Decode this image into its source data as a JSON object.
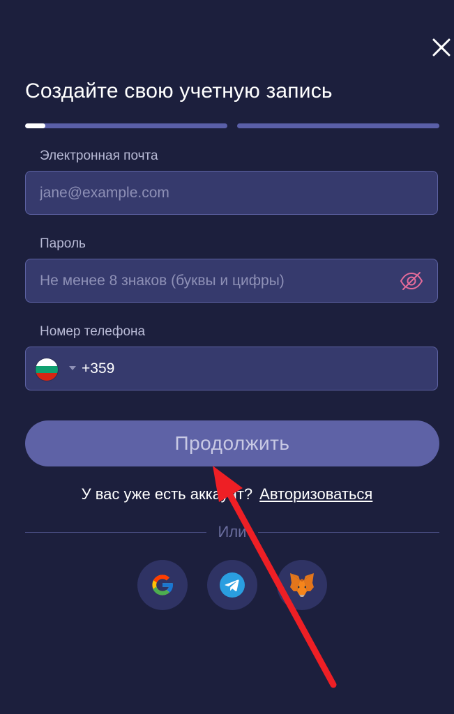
{
  "title": "Создайте свою учетную запись",
  "progress": [
    0.1,
    0
  ],
  "email": {
    "label": "Электронная почта",
    "placeholder": "jane@example.com",
    "value": ""
  },
  "password": {
    "label": "Пароль",
    "placeholder": "Не менее 8 знаков (буквы и цифры)",
    "value": ""
  },
  "phone": {
    "label": "Номер телефона",
    "country_flag": "bulgaria-flag",
    "value": "+359"
  },
  "continue_button": {
    "label": "Продолжить"
  },
  "login_prompt": {
    "text": "У вас уже есть аккаунт?",
    "link": "Авторизоваться"
  },
  "divider_text": "Или",
  "social_buttons": [
    {
      "name": "google-icon"
    },
    {
      "name": "telegram-icon"
    },
    {
      "name": "metamask-icon"
    }
  ],
  "colors": {
    "background": "#1c1f3d",
    "field_bg": "#363a6d",
    "field_border": "#5d62a3",
    "button_bg": "#5e62a6",
    "eye_icon": "#e46b9a",
    "annotation_arrow": "#ee1f25"
  }
}
